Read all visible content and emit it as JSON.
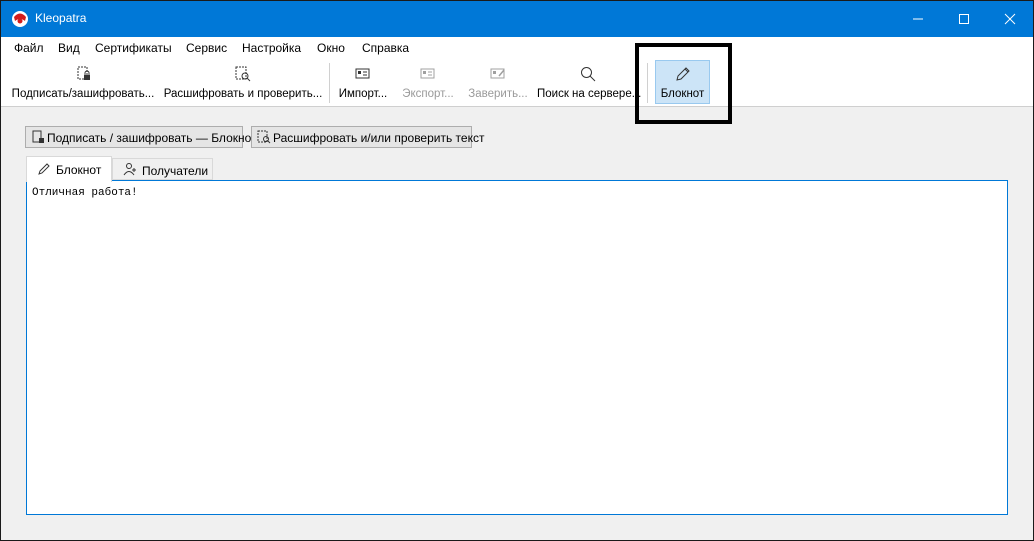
{
  "window": {
    "title": "Kleopatra"
  },
  "menu": [
    "Файл",
    "Вид",
    "Сертификаты",
    "Сервис",
    "Настройка",
    "Окно",
    "Справка"
  ],
  "toolbar": {
    "sign_encrypt": "Подписать/зашифровать...",
    "decrypt_verify": "Расшифровать и проверить...",
    "import": "Импорт...",
    "export": "Экспорт...",
    "certify": "Заверить...",
    "lookup": "Поиск на сервере...",
    "notepad": "Блокнот"
  },
  "actions": {
    "sign_encrypt_notepad": "Подписать / зашифровать — Блокнот",
    "decrypt_verify_text": "Расшифровать и/или проверить текст"
  },
  "tabs": {
    "notepad": "Блокнот",
    "recipients": "Получатели"
  },
  "editor": {
    "text": "Отличная работа!"
  },
  "colors": {
    "titlebar": "#0078d7",
    "active_tool": "#cce4f7",
    "editor_border": "#0078d7"
  }
}
